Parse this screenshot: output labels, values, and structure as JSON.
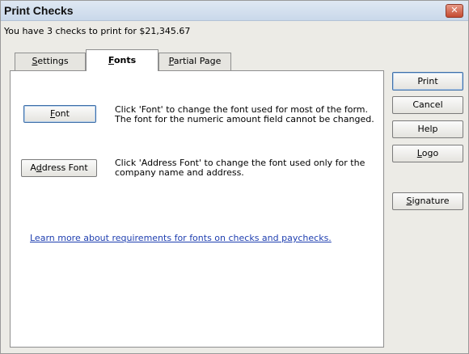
{
  "window": {
    "title": "Print Checks",
    "close_glyph": "✕"
  },
  "summary": "You have 3 checks to print for $21,345.67",
  "tabs": [
    {
      "pre": "",
      "u": "S",
      "post": "ettings"
    },
    {
      "pre": "",
      "u": "F",
      "post": "onts"
    },
    {
      "pre": "",
      "u": "P",
      "post": "artial Page"
    }
  ],
  "fonts_tab": {
    "font_button": {
      "pre": "",
      "u": "F",
      "post": "ont"
    },
    "font_desc": "Click 'Font' to change the font used for most of the form. The font for the numeric amount field cannot be changed.",
    "address_font_button": {
      "pre": "A",
      "u": "d",
      "post": "dress Font"
    },
    "address_font_desc": "Click 'Address Font' to change the font used only for the company name and address.",
    "learn_more_link": "Learn more about requirements for fonts on checks and paychecks."
  },
  "side_buttons": {
    "print": "Print",
    "cancel": "Cancel",
    "help": "Help",
    "logo": {
      "pre": "",
      "u": "L",
      "post": "ogo"
    },
    "signature": {
      "pre": "",
      "u": "S",
      "post": "ignature"
    }
  },
  "active_tab": "Fonts"
}
